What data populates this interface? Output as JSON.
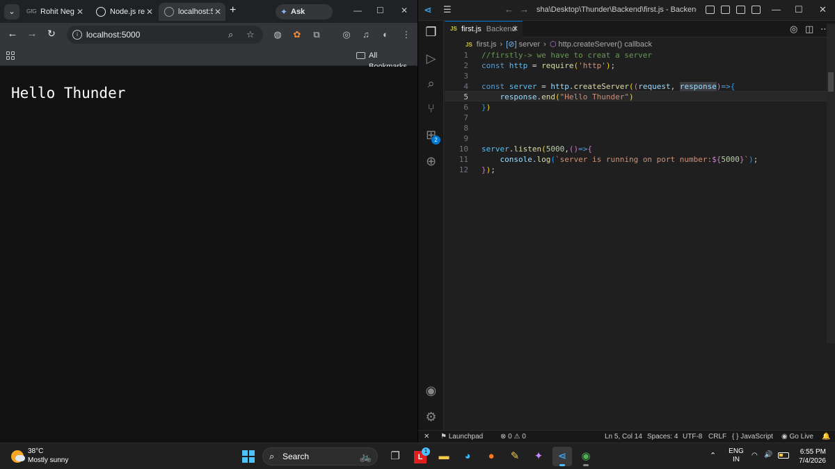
{
  "browser": {
    "tabs": [
      {
        "label": "Rohit Neg",
        "favicon": "GfG"
      },
      {
        "label": "Node.js re",
        "favicon": ""
      },
      {
        "label": "localhost:5",
        "favicon": ""
      }
    ],
    "new_tab": "+",
    "gemini_label": "Ask Gemini",
    "url": "localhost:5000",
    "bookmarks_label": "All Bookmarks",
    "page_text": "Hello Thunder"
  },
  "vscode": {
    "title": "sha\\Desktop\\Thunder\\Backend\\first.js - Backend - Visua",
    "tab": {
      "icon": "JS",
      "name": "first.js",
      "folder": "Backend"
    },
    "breadcrumb": {
      "icon": "JS",
      "file": "first.js",
      "symbol1": "server",
      "symbol2": "http.createServer() callback"
    },
    "activity_badge": "2",
    "line_numbers": [
      "1",
      "2",
      "3",
      "4",
      "5",
      "6",
      "7",
      "8",
      "9",
      "10",
      "11",
      "12"
    ],
    "status": {
      "launchpad": "Launchpad",
      "errors": "0",
      "warnings": "0",
      "position": "Ln 5, Col 14",
      "spaces": "Spaces: 4",
      "encoding": "UTF-8",
      "eol": "CRLF",
      "language": "JavaScript",
      "golive": "Go Live"
    }
  },
  "taskbar": {
    "temperature": "38°C",
    "weather": "Mostly sunny",
    "search_label": "Search",
    "notification_badge": "1",
    "lang_top": "ENG",
    "lang_bottom": "IN",
    "time": "6:55 PM",
    "date": "7/4/2026"
  }
}
